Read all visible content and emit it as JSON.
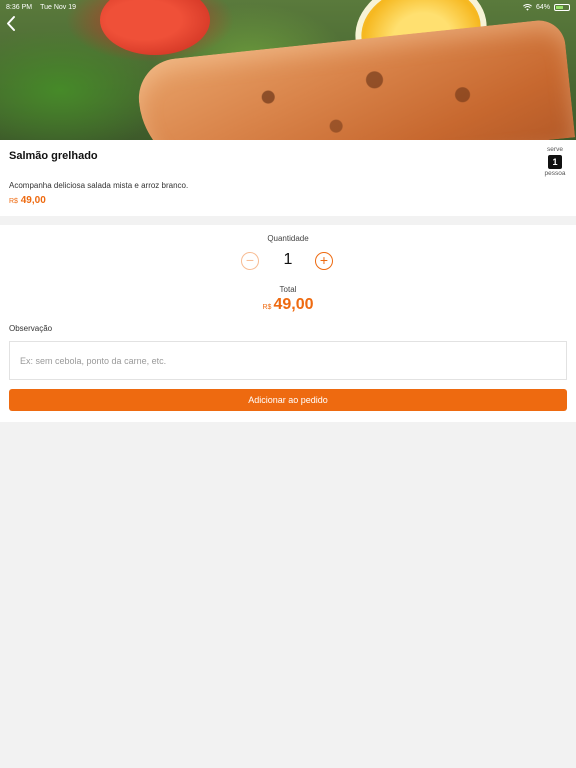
{
  "status_bar": {
    "time": "8:36 PM",
    "date": "Tue Nov 19",
    "battery": "64%"
  },
  "product": {
    "name": "Salmão grelhado",
    "description": "Acompanha deliciosa salada mista e arroz branco.",
    "currency": "R$",
    "price": "49,00",
    "serves_label_top": "serve",
    "serves_count": "1",
    "serves_label_bottom": "pessoa"
  },
  "order": {
    "quantity_label": "Quantidade",
    "minus": "−",
    "quantity": "1",
    "plus": "+",
    "total_label": "Total",
    "total_currency": "R$",
    "total_value": "49,00",
    "observation_label": "Observação",
    "observation_placeholder": "Ex: sem cebola, ponto da carne, etc.",
    "add_button_label": "Adicionar ao pedido"
  },
  "colors": {
    "accent": "#ee6a10",
    "background": "#f2f2f2"
  },
  "icons": {
    "back": "chevron-left-icon",
    "wifi": "wifi-icon",
    "battery": "battery-icon"
  }
}
